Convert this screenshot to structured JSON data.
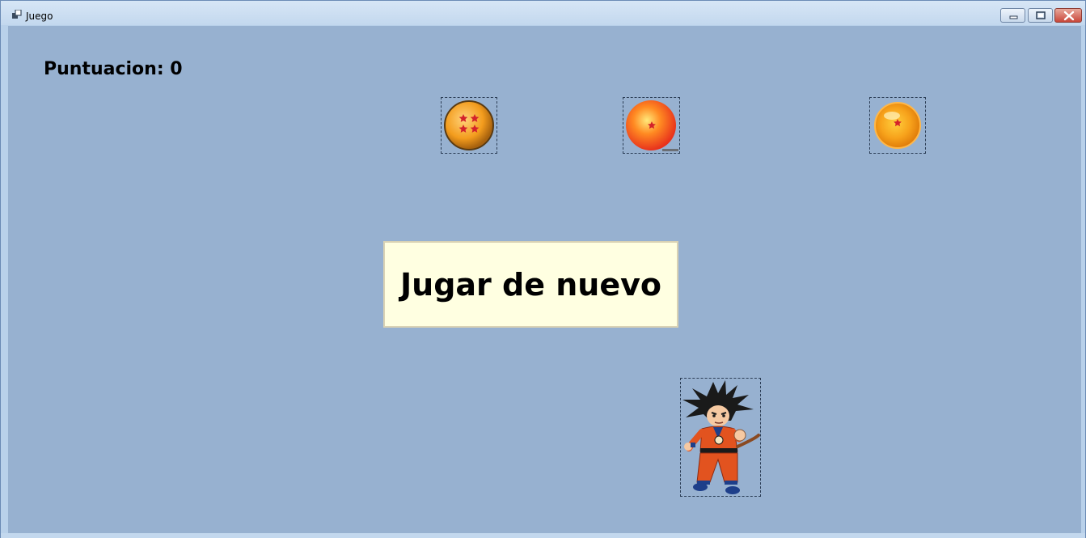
{
  "window": {
    "title": "Juego",
    "icons": {
      "app": "app-window-icon",
      "minimize": "minimize-icon",
      "maximize": "maximize-icon",
      "close": "close-icon"
    }
  },
  "game": {
    "score_text": "Puntuacion: 0",
    "score_value": 0,
    "play_again_label": "Jugar de nuevo",
    "sprites": [
      {
        "name": "dragon-ball-4-star",
        "stars": 4
      },
      {
        "name": "dragon-ball-1-star",
        "stars": 1
      },
      {
        "name": "dragon-ball-1-star",
        "stars": 1
      },
      {
        "name": "goku-player"
      }
    ]
  },
  "colors": {
    "client_background": "#97b1d0",
    "button_background": "#ffffe1",
    "ball_orange": "#f7a21b",
    "star_red": "#d3222a",
    "goku_gi": "#e2531f"
  }
}
